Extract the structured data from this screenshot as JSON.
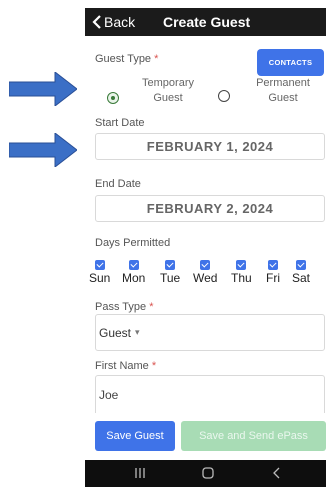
{
  "header": {
    "back_label": "Back",
    "title": "Create Guest"
  },
  "guest_type": {
    "label": "Guest Type",
    "required_mark": "*",
    "contacts_button": "CONTACTS",
    "options": [
      {
        "label_line1": "Temporary",
        "label_line2": "Guest",
        "selected": true
      },
      {
        "label_line1": "Permanent",
        "label_line2": "Guest",
        "selected": false
      }
    ]
  },
  "start_date": {
    "label": "Start Date",
    "value": "FEBRUARY 1, 2024"
  },
  "end_date": {
    "label": "End Date",
    "value": "FEBRUARY 2, 2024"
  },
  "days_permitted": {
    "label": "Days Permitted",
    "days": [
      {
        "label": "Sun",
        "checked": true
      },
      {
        "label": "Mon",
        "checked": true
      },
      {
        "label": "Tue",
        "checked": true
      },
      {
        "label": "Wed",
        "checked": true
      },
      {
        "label": "Thu",
        "checked": true
      },
      {
        "label": "Fri",
        "checked": true
      },
      {
        "label": "Sat",
        "checked": true
      }
    ]
  },
  "pass_type": {
    "label": "Pass Type",
    "required_mark": "*",
    "value": "Guest",
    "caret": "▾"
  },
  "first_name": {
    "label": "First Name",
    "required_mark": "*",
    "value": "Joe"
  },
  "actions": {
    "save_label": "Save Guest",
    "save_send_label": "Save and Send ePass"
  },
  "colors": {
    "primary": "#3f73e8",
    "disabled_green": "#a8dcb5",
    "titlebar": "#1b1b1b",
    "arrow": "#3b6fc6",
    "radio_selected": "#3a7a3a"
  },
  "icons": {
    "back": "chevron-left-icon",
    "recent_apps": "recent-apps-icon",
    "home": "home-icon",
    "system_back": "system-back-icon",
    "pointer_arrow": "arrow-right-icon"
  }
}
